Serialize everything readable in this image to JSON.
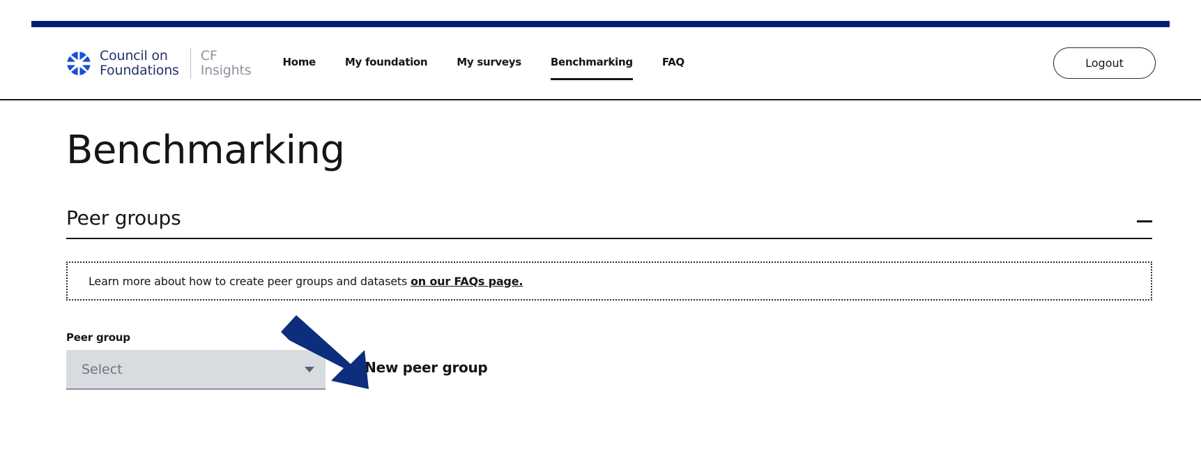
{
  "brand": {
    "logo_icon": "council-on-foundations-aperture-icon",
    "name_line1": "Council on",
    "name_line2": "Foundations",
    "product_line1": "CF",
    "product_line2": "Insights"
  },
  "nav": {
    "items": [
      {
        "label": "Home",
        "active": false
      },
      {
        "label": "My foundation",
        "active": false
      },
      {
        "label": "My surveys",
        "active": false
      },
      {
        "label": "Benchmarking",
        "active": true
      },
      {
        "label": "FAQ",
        "active": false
      }
    ],
    "logout_label": "Logout"
  },
  "page": {
    "title": "Benchmarking"
  },
  "peer_groups_section": {
    "title": "Peer groups",
    "collapse_icon": "minus-icon",
    "info": {
      "text": "Learn more about how to create peer groups and datasets ",
      "link_text": "on our FAQs page."
    },
    "peer_group_field": {
      "label": "Peer group",
      "placeholder": "Select",
      "value": "Select",
      "caret_icon": "chevron-down-icon"
    },
    "new_peer_group_button": {
      "plus_icon": "plus-icon",
      "label": "New peer group"
    }
  },
  "annotation": {
    "arrow_icon": "arrow-pointing-down-right",
    "color": "#0d2d7d"
  },
  "colors": {
    "accent_bar": "#031f73",
    "brand_navy": "#23306b",
    "brand_blue": "#1a4fd6",
    "text": "#15161a",
    "select_bg": "#d8dbe0"
  }
}
